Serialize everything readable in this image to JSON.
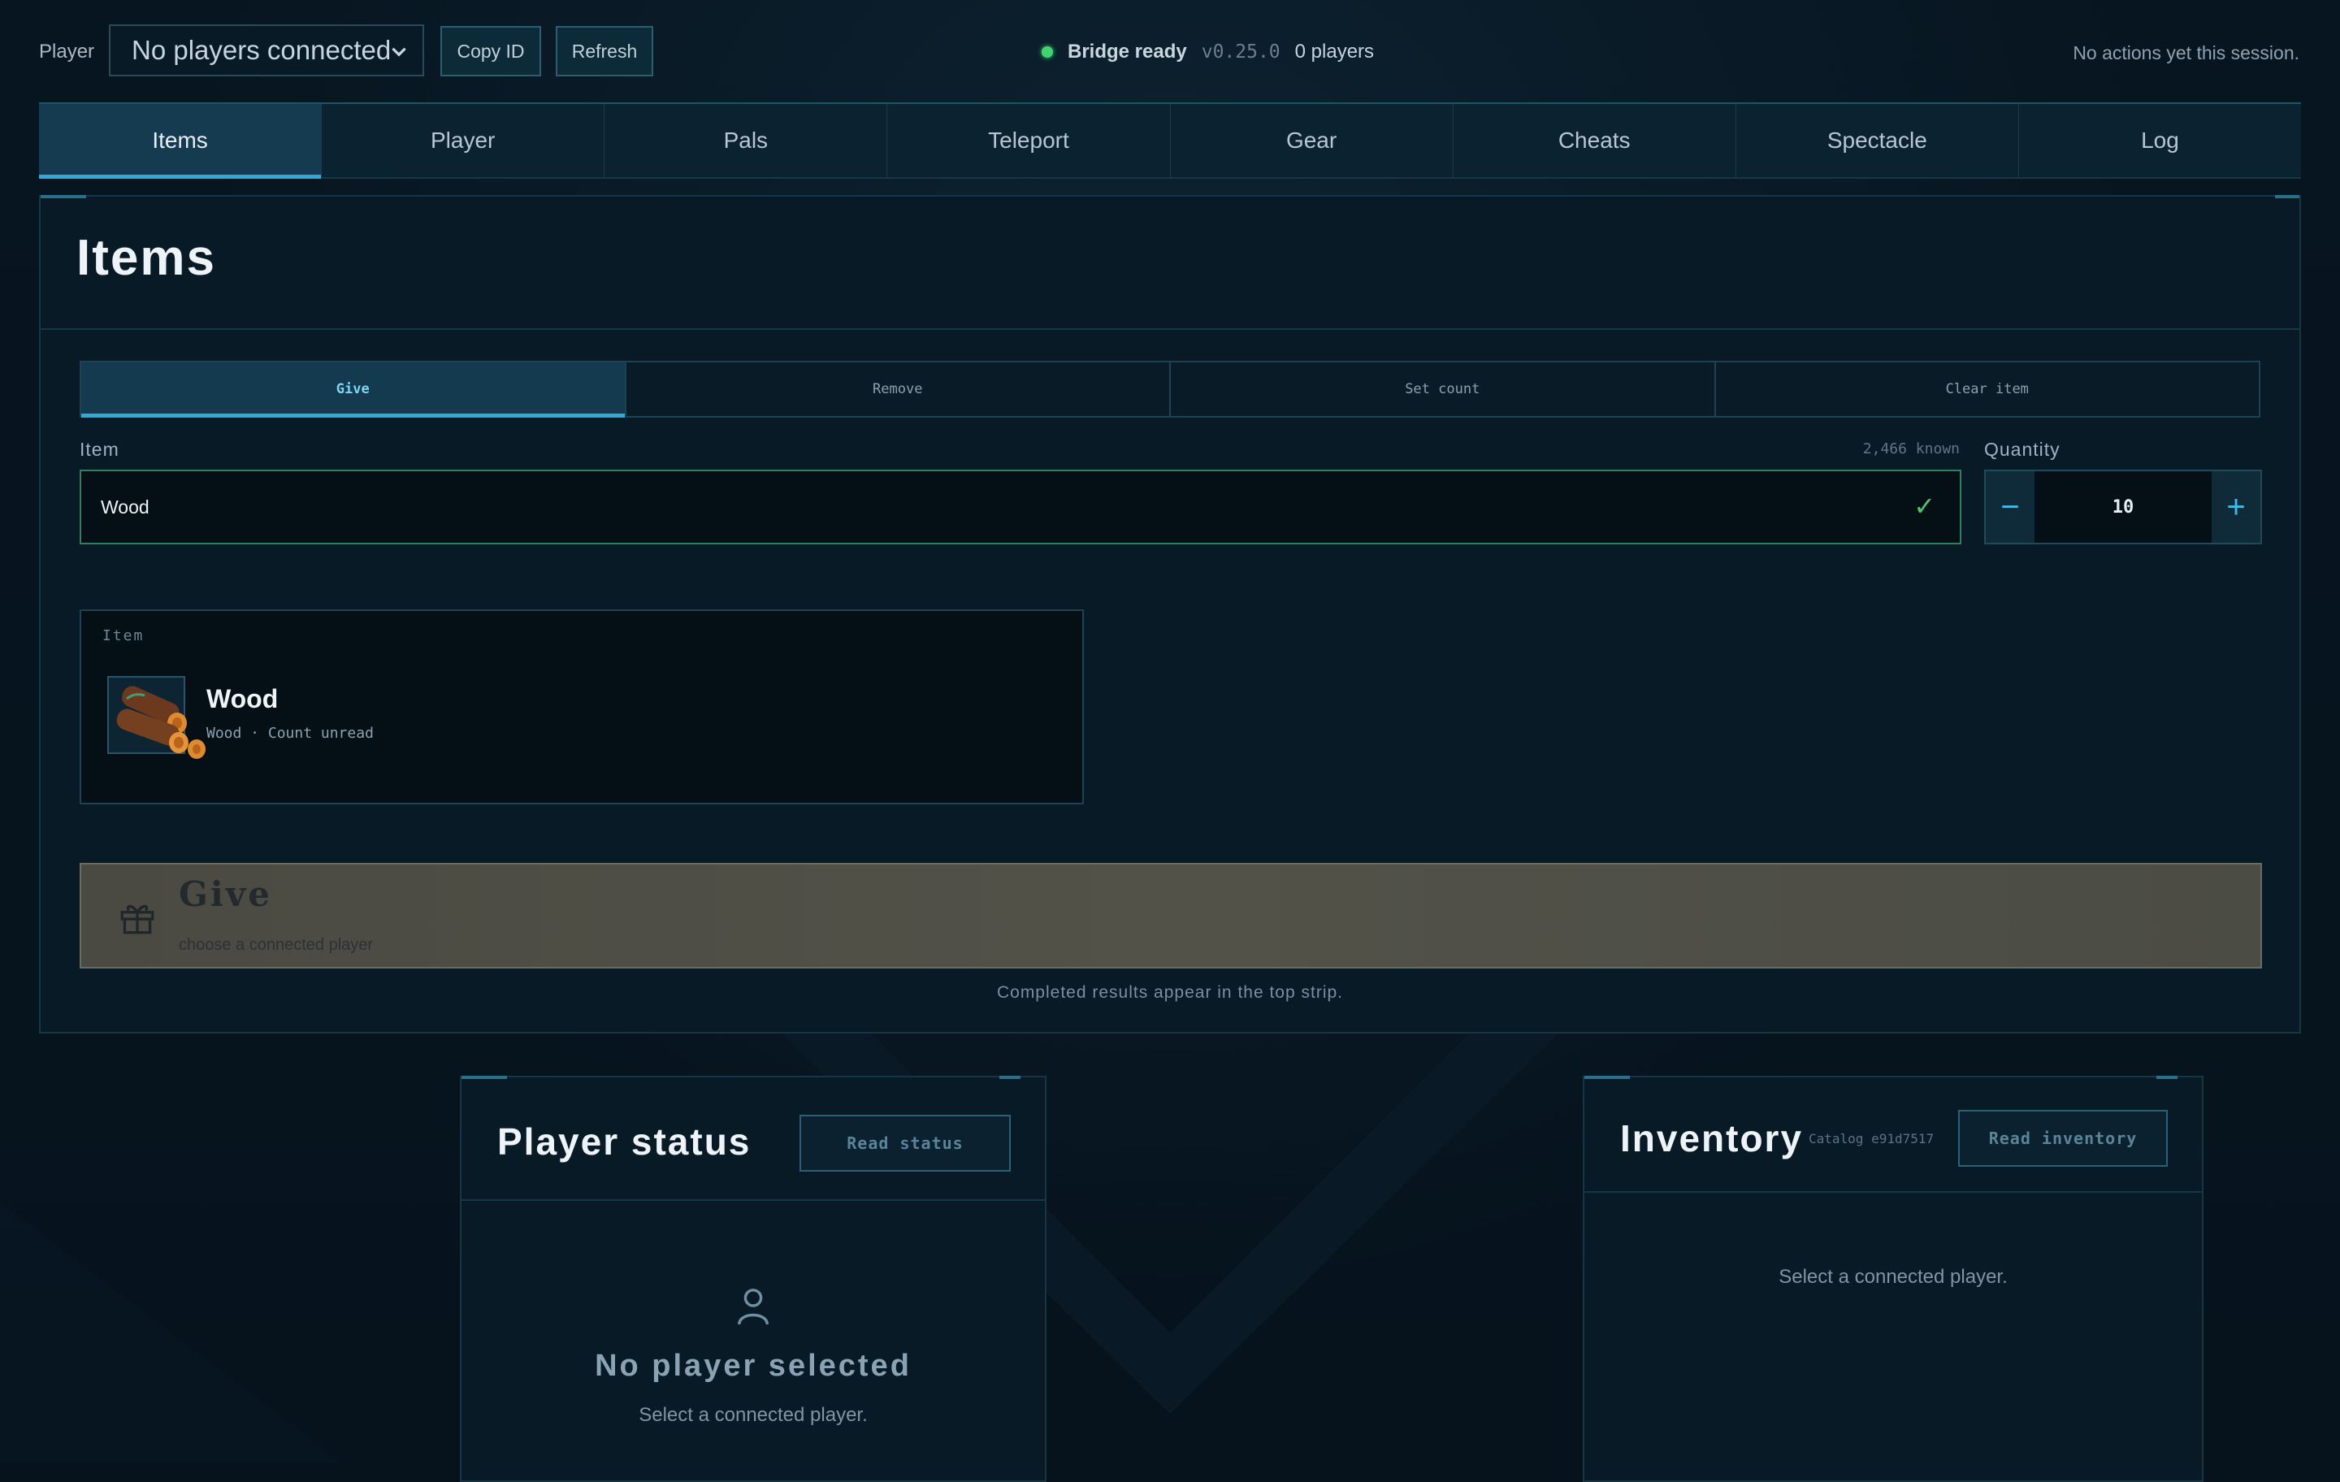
{
  "topbar": {
    "player_label": "Player",
    "player_select_value": "No players connected",
    "copy_id_label": "Copy ID",
    "refresh_label": "Refresh",
    "bridge_status": "Bridge ready",
    "version": "v0.25.0",
    "players_count": "0 players",
    "actions_message": "No actions yet this session.",
    "status_color": "#3fd56e"
  },
  "tabs": [
    "Items",
    "Player",
    "Pals",
    "Teleport",
    "Gear",
    "Cheats",
    "Spectacle",
    "Log"
  ],
  "active_tab": "Items",
  "items_panel": {
    "title": "Items",
    "subtabs": [
      "Give",
      "Remove",
      "Set count",
      "Clear item"
    ],
    "active_subtab": "Give",
    "item_label": "Item",
    "known_count": "2,466 known",
    "item_value": "Wood",
    "quantity_label": "Quantity",
    "quantity_value": "10",
    "quantity_minus": "−",
    "quantity_plus": "+",
    "card": {
      "kicker": "Item",
      "name": "Wood",
      "subtitle": "Wood · Count unread"
    },
    "give_button": {
      "title": "Give",
      "subtitle": "choose a connected player",
      "icon": "gift-icon"
    },
    "result_note": "Completed results appear in the top strip."
  },
  "status_panel": {
    "title": "Player status",
    "read_button": "Read status",
    "empty_title": "No player selected",
    "empty_sub": "Select a connected player.",
    "icon": "user-icon"
  },
  "inventory_panel": {
    "title": "Inventory",
    "catalog": "Catalog e91d7517",
    "read_button": "Read inventory",
    "empty_sub": "Select a connected player."
  },
  "colors": {
    "accent": "#2fa9d6",
    "ok": "#4ec66f",
    "background": "#06121c"
  }
}
